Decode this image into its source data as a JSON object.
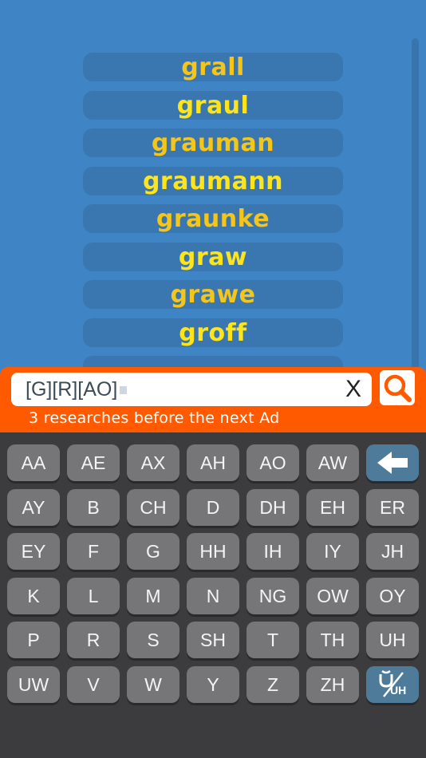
{
  "results": [
    {
      "word": "grall",
      "color": "#f5c518"
    },
    {
      "word": "graul",
      "color": "#ffe419"
    },
    {
      "word": "grauman",
      "color": "#f5c518"
    },
    {
      "word": "graumann",
      "color": "#ffe419"
    },
    {
      "word": "graunke",
      "color": "#f5c518"
    },
    {
      "word": "graw",
      "color": "#ffe419"
    },
    {
      "word": "grawe",
      "color": "#f5c518"
    },
    {
      "word": "groff",
      "color": "#ffe419"
    },
    {
      "word": "",
      "color": "#f5c518"
    }
  ],
  "search": {
    "query": "[G][R][AO]",
    "clear_label": "X",
    "ad_notice": "3 researches before the next Ad",
    "accent_color": "#ff5a00"
  },
  "keyboard": {
    "rows": [
      [
        "AA",
        "AE",
        "AX",
        "AH",
        "AO",
        "AW",
        "backspace"
      ],
      [
        "AY",
        "B",
        "CH",
        "D",
        "DH",
        "EH",
        "ER"
      ],
      [
        "EY",
        "F",
        "G",
        "HH",
        "IH",
        "IY",
        "JH"
      ],
      [
        "K",
        "L",
        "M",
        "N",
        "NG",
        "OW",
        "OY"
      ],
      [
        "P",
        "R",
        "S",
        "SH",
        "T",
        "TH",
        "UH"
      ],
      [
        "UW",
        "V",
        "W",
        "Y",
        "Z",
        "ZH",
        "toggle-uh"
      ]
    ],
    "toggle_sub_label": "UH",
    "icons": {
      "backspace": "arrow-left-icon",
      "search": "magnifier-icon"
    }
  }
}
